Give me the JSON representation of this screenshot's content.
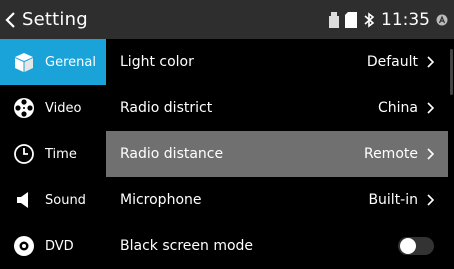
{
  "header": {
    "title": "Setting",
    "time": "11:35"
  },
  "sidebar": {
    "items": [
      {
        "label": "Gerenal",
        "icon": "cube-icon",
        "active": true
      },
      {
        "label": "Video",
        "icon": "film-reel-icon",
        "active": false
      },
      {
        "label": "Time",
        "icon": "clock-icon",
        "active": false
      },
      {
        "label": "Sound",
        "icon": "speaker-icon",
        "active": false
      },
      {
        "label": "DVD",
        "icon": "disc-icon",
        "active": false
      }
    ]
  },
  "settings": {
    "rows": [
      {
        "label": "Light color",
        "value": "Default"
      },
      {
        "label": "Radio district",
        "value": "China"
      },
      {
        "label": "Radio distance",
        "value": "Remote",
        "highlighted": true
      },
      {
        "label": "Microphone",
        "value": "Built-in"
      },
      {
        "label": "Black screen mode",
        "toggle_on": false
      }
    ]
  },
  "colors": {
    "accent": "#1aa3d9",
    "header_bg": "#2e2e2e",
    "highlight_row": "#707070"
  }
}
